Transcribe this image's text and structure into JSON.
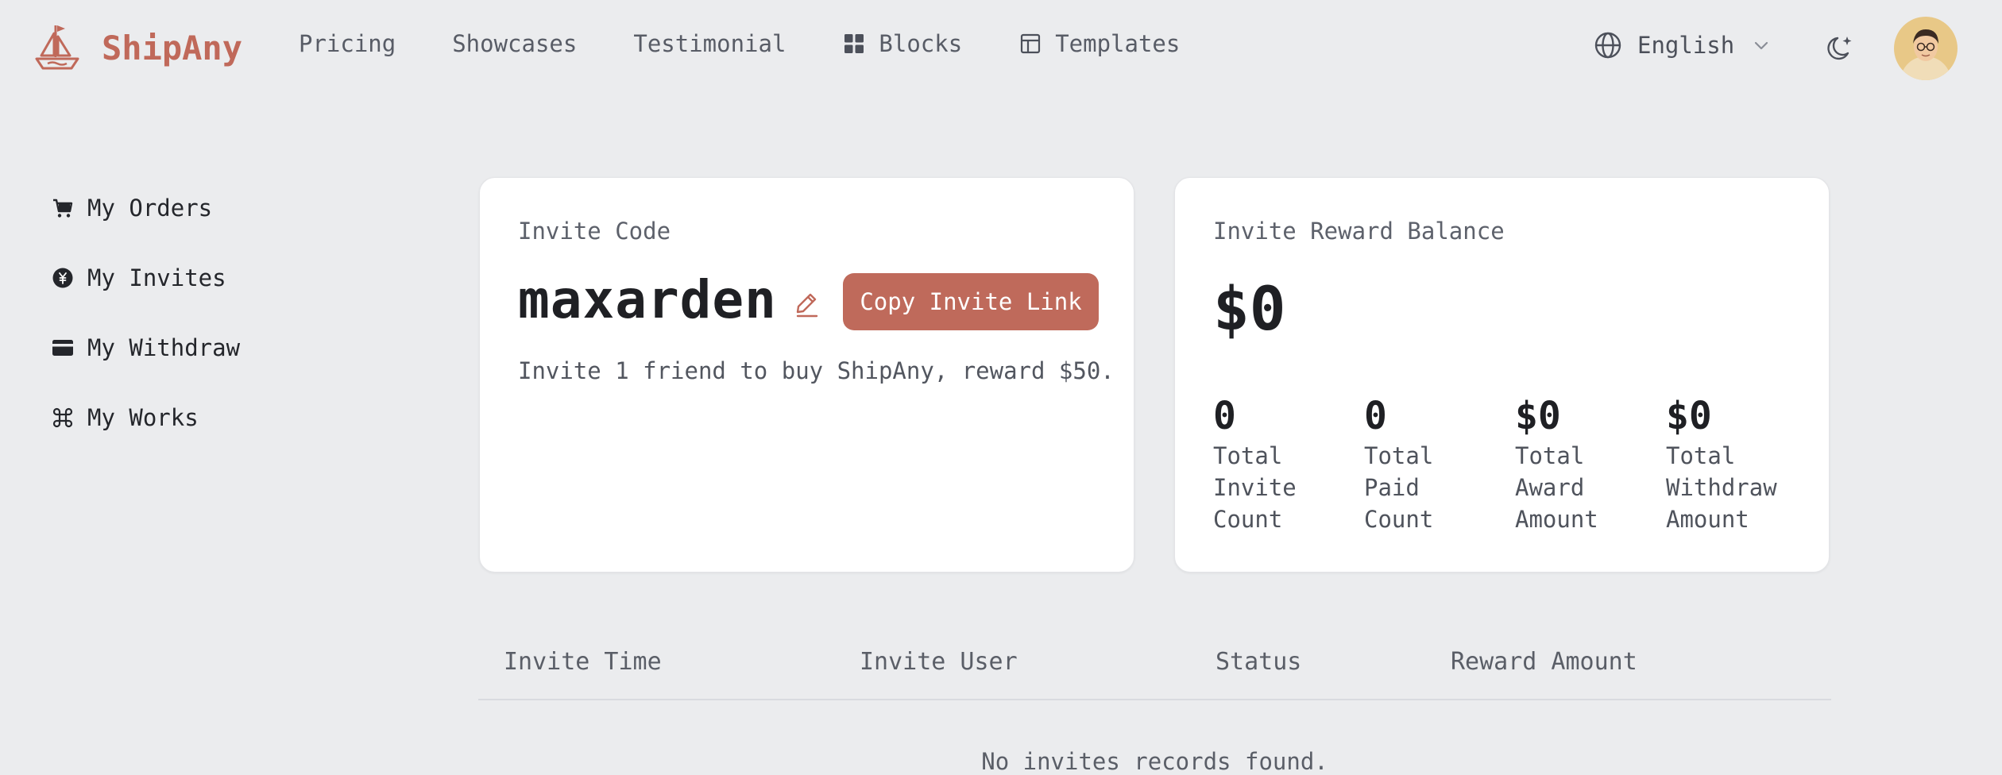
{
  "header": {
    "brand": "ShipAny",
    "nav": [
      {
        "label": "Pricing",
        "icon": null
      },
      {
        "label": "Showcases",
        "icon": null
      },
      {
        "label": "Testimonial",
        "icon": null
      },
      {
        "label": "Blocks",
        "icon": "grid-icon"
      },
      {
        "label": "Templates",
        "icon": "layout-icon"
      }
    ],
    "language": "English",
    "accent_color": "#c0695a"
  },
  "sidebar": {
    "items": [
      {
        "label": "My Orders",
        "icon": "cart-icon"
      },
      {
        "label": "My Invites",
        "icon": "currency-circle-icon"
      },
      {
        "label": "My Withdraw",
        "icon": "credit-card-icon"
      },
      {
        "label": "My Works",
        "icon": "command-icon"
      }
    ]
  },
  "invite_card": {
    "label": "Invite Code",
    "code": "maxarden",
    "copy_button": "Copy Invite Link",
    "description": "Invite 1 friend to buy ShipAny, reward $50."
  },
  "balance_card": {
    "label": "Invite Reward Balance",
    "amount": "$0",
    "stats": [
      {
        "value": "0",
        "label": "Total Invite Count"
      },
      {
        "value": "0",
        "label": "Total Paid Count"
      },
      {
        "value": "$0",
        "label": "Total Award Amount"
      },
      {
        "value": "$0",
        "label": "Total Withdraw Amount"
      }
    ]
  },
  "table": {
    "columns": [
      "Invite Time",
      "Invite User",
      "Status",
      "Reward Amount"
    ],
    "empty_message": "No invites records found."
  }
}
